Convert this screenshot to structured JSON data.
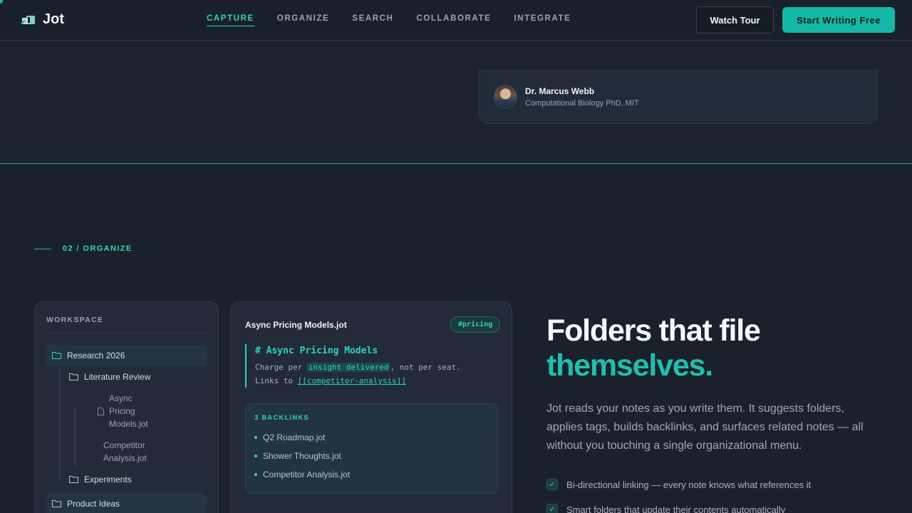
{
  "nav": {
    "brand": "Jot",
    "links": [
      "CAPTURE",
      "ORGANIZE",
      "SEARCH",
      "COLLABORATE",
      "INTEGRATE"
    ],
    "active_link": "CAPTURE",
    "watch_tour": "Watch Tour",
    "start_writing": "Start Writing Free"
  },
  "testimonial": {
    "author_name": "Dr. Marcus Webb",
    "author_role": "Computational Biology PhD, MIT"
  },
  "section": {
    "label": "02 / ORGANIZE"
  },
  "workspace": {
    "title": "WORKSPACE",
    "research": "Research 2026",
    "literature": "Literature Review",
    "async_file": [
      "Async",
      "Pricing",
      "Models.jot"
    ],
    "competitor_file": [
      "Competitor",
      "Analysis.jot"
    ],
    "experiments": "Experiments",
    "product_ideas": "Product Ideas"
  },
  "editor": {
    "file_name": "Async Pricing Models.jot",
    "tag": "#pricing",
    "heading": "# Async Pricing Models",
    "line1_pre": "Charge per ",
    "line1_mark": "insight delivered",
    "line1_post": ", not per seat.",
    "line2_pre": "Links to ",
    "line2_link": "[[competitor-analysis]]",
    "backlinks_title": "3 BACKLINKS",
    "backlinks": [
      "Q2 Roadmap.jot",
      "Shower Thoughts.jot",
      "Competitor Analysis.jot"
    ]
  },
  "copy": {
    "headline_1": "Folders that file",
    "headline_2": "themselves.",
    "body": "Jot reads your notes as you write them. It suggests folders, applies tags, builds backlinks, and surfaces related notes — all without you touching a single organizational menu.",
    "features": [
      "Bi-directional linking — every note knows what references it",
      "Smart folders that update their contents automatically"
    ]
  },
  "colors": {
    "accent": "#14b8a6",
    "background": "#1b212b"
  }
}
